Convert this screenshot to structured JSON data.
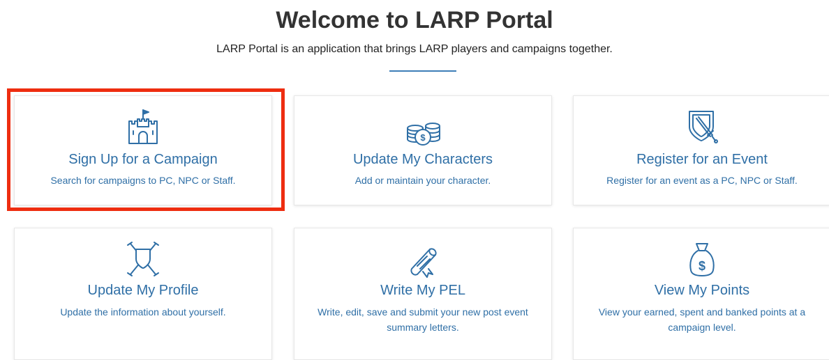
{
  "header": {
    "title": "Welcome to LARP Portal",
    "subtitle": "LARP Portal is an application that brings LARP players and campaigns together."
  },
  "colors": {
    "accent": "#2f6fa6",
    "highlight": "#ee2d10",
    "title": "#333333"
  },
  "cards": [
    {
      "icon": "castle-icon",
      "title": "Sign Up for a Campaign",
      "description": "Search for campaigns to PC, NPC or Staff.",
      "highlighted": true
    },
    {
      "icon": "coins-icon",
      "title": "Update My Characters",
      "description": "Add or maintain your character."
    },
    {
      "icon": "shield-sword-icon",
      "title": "Register for an Event",
      "description": "Register for an event as a PC, NPC or Staff."
    },
    {
      "icon": "crossed-swords-shield-icon",
      "title": "Update My Profile",
      "description": "Update the information about yourself."
    },
    {
      "icon": "scroll-icon",
      "title": "Write My PEL",
      "description": "Write, edit, save and submit your new post event summary letters."
    },
    {
      "icon": "money-bag-icon",
      "title": "View My Points",
      "description": "View your earned, spent and banked points at a campaign level."
    }
  ]
}
